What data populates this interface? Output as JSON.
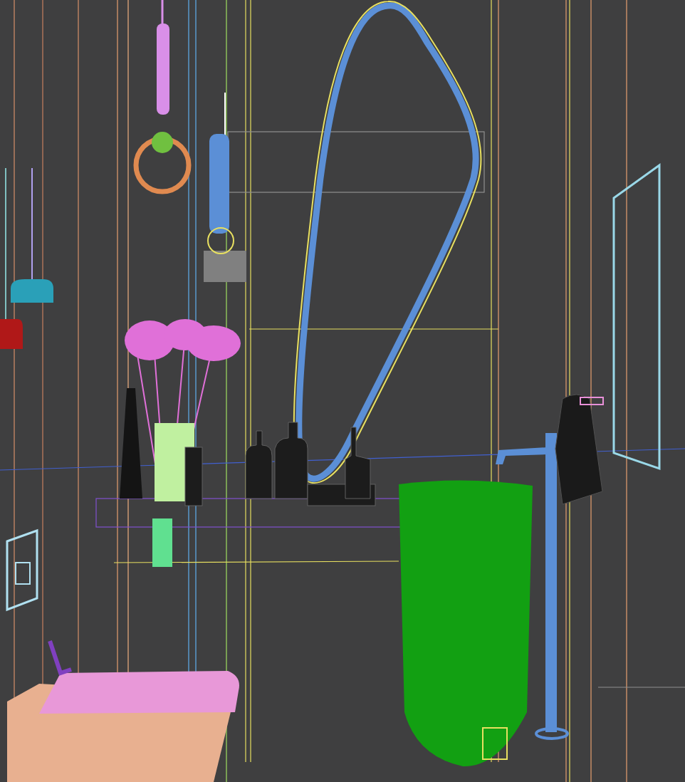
{
  "viewport": {
    "objects": [
      {
        "kind": "ring-pendant",
        "color": "#d98fe8"
      },
      {
        "kind": "cylinder-pendant",
        "color": "#5b8fd6"
      },
      {
        "kind": "dome-pendant",
        "color": "#2aa0b8"
      },
      {
        "kind": "mirror",
        "color": "#5b8fd6"
      },
      {
        "kind": "flowers",
        "color": "#e070d8"
      },
      {
        "kind": "vase",
        "color": "#c0f0a0"
      },
      {
        "kind": "bottles",
        "color": "#1c1c1c"
      },
      {
        "kind": "basin",
        "color": "#12a012"
      },
      {
        "kind": "faucet",
        "color": "#5b8fd6"
      },
      {
        "kind": "towel",
        "color": "#1a1a1a"
      },
      {
        "kind": "wall-frame",
        "color": "#9ad8e8"
      },
      {
        "kind": "toilet",
        "color": "#e898d8"
      },
      {
        "kind": "flush-plate",
        "color": "#b0e0f0"
      }
    ]
  }
}
